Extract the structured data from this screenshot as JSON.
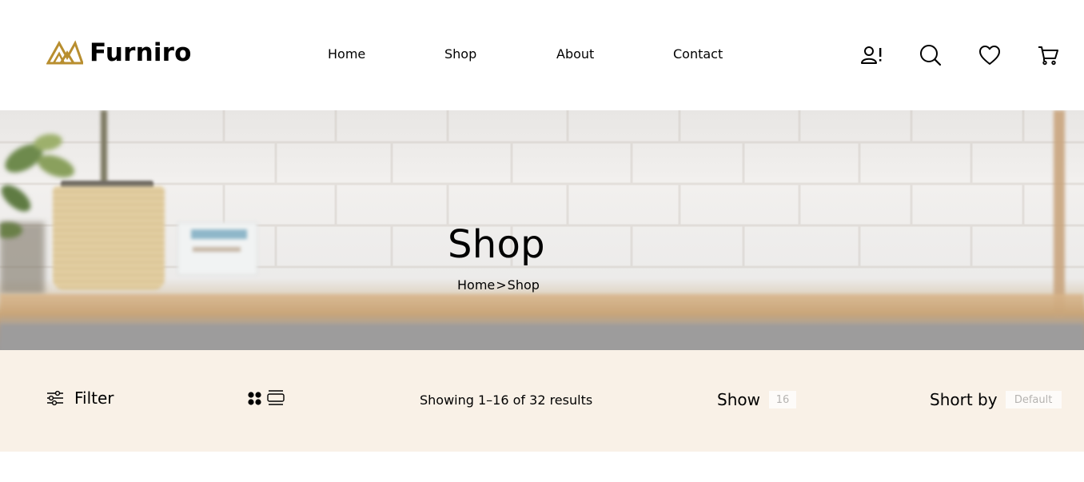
{
  "brand": {
    "name": "Furniro",
    "logo_icon": "logo-mountains-icon",
    "color": "#B88E2F"
  },
  "nav": {
    "items": [
      {
        "label": "Home"
      },
      {
        "label": "Shop"
      },
      {
        "label": "About"
      },
      {
        "label": "Contact"
      }
    ]
  },
  "header_icons": [
    "account-alert-icon",
    "search-icon",
    "heart-icon",
    "cart-icon"
  ],
  "hero": {
    "title": "Shop",
    "breadcrumb": {
      "home": "Home",
      "separator": ">",
      "current": "Shop"
    }
  },
  "toolbar": {
    "filter_label": "Filter",
    "filter_icon": "sliders-icon",
    "view_icons": [
      "grid-view-icon",
      "list-view-icon"
    ],
    "results_text": "Showing 1–16 of 32 results",
    "show_label": "Show",
    "show_value": "16",
    "sort_label": "Short by",
    "sort_value": "Default",
    "background": "#F9F1E7"
  }
}
